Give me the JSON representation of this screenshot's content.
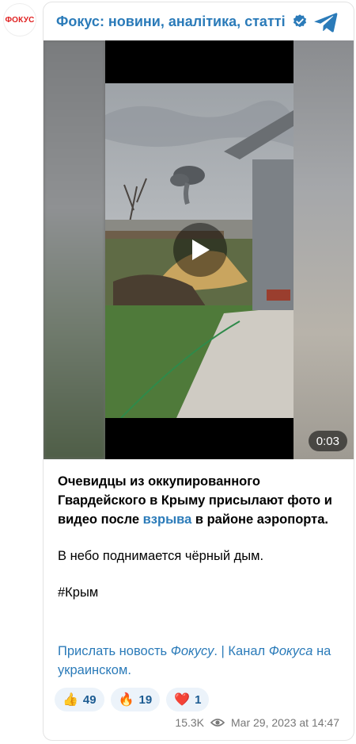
{
  "logo": {
    "text": "ФОКУС"
  },
  "channel": {
    "title": "Фокус: новини, аналітика, статті"
  },
  "video": {
    "duration": "0:03"
  },
  "post": {
    "p1_before": "Очевидцы из оккупированного Гвардейского в Крыму присылают фото и видео после ",
    "p1_link": "взрыва",
    "p1_after": " в районе аэропорта.",
    "p2": "В небо поднимается чёрный дым.",
    "p3": "#Крым"
  },
  "links": {
    "send_news_prefix": "Прислать новость ",
    "send_news_italic": "Фокусу",
    "separator": ". | ",
    "channel_prefix": "Канал ",
    "channel_italic": "Фокуса",
    "channel_suffix": " на украинском."
  },
  "reactions": [
    {
      "emoji": "👍",
      "count": "49"
    },
    {
      "emoji": "🔥",
      "count": "19"
    },
    {
      "emoji": "❤️",
      "count": "1"
    }
  ],
  "meta": {
    "views": "15.3K",
    "date": "Mar 29, 2023 at 14:47"
  },
  "colors": {
    "accent": "#2b7bb9",
    "logo_red": "#e02020",
    "reaction_bg": "#ecf3fa"
  },
  "icons": {
    "verified": "verified-badge-icon",
    "telegram": "telegram-plane-icon",
    "play": "play-icon",
    "views": "eye-icon"
  }
}
